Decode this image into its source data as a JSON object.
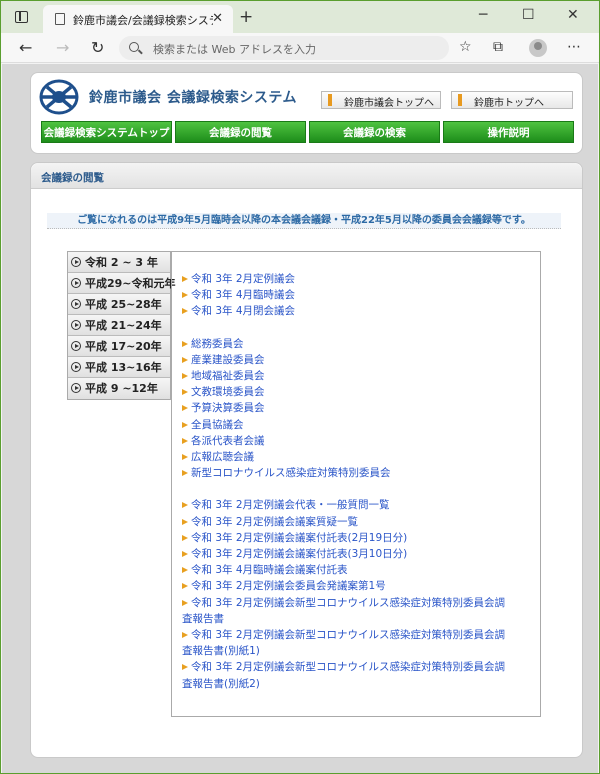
{
  "browser": {
    "tab_title": "鈴鹿市議会/会議録検索システム",
    "tab_close": "✕",
    "new_tab": "+",
    "address_placeholder": "検索または Web アドレスを入力",
    "back": "←",
    "forward": "→",
    "reload": "↻",
    "minimize": "─",
    "maximize": "☐",
    "close": "✕"
  },
  "header": {
    "site_title": "鈴鹿市議会 会議録検索システム",
    "links": [
      "鈴鹿市議会トップへ",
      "鈴鹿市トップへ"
    ],
    "menu": [
      "会議録検索システムトップ",
      "会議録の閲覧",
      "会議録の検索",
      "操作説明"
    ]
  },
  "section": {
    "title": "会議録の閲覧",
    "notice": "ご覧になれるのは平成9年5月臨時会以降の本会議会議録・平成22年5月以降の委員会会議録等です。"
  },
  "year_nav": [
    "令和 2 ~ 3 年",
    "平成29~令和元年",
    "平成 25~28年",
    "平成 21~24年",
    "平成 17~20年",
    "平成 13~16年",
    "平成 9 ~12年"
  ],
  "link_groups": [
    [
      "令和 3年 2月定例議会",
      "令和 3年 4月臨時議会",
      "令和 3年 4月閉会議会"
    ],
    [
      "総務委員会",
      "産業建設委員会",
      "地域福祉委員会",
      "文教環境委員会",
      "予算決算委員会",
      "全員協議会",
      "各派代表者会議",
      "広報広聴会議",
      "新型コロナウイルス感染症対策特別委員会"
    ],
    [
      "令和 3年 2月定例議会代表・一般質問一覧",
      "令和 3年 2月定例議会議案質疑一覧",
      "令和 3年 2月定例議会議案付託表(2月19日分)",
      "令和 3年 2月定例議会議案付託表(3月10日分)",
      "令和 3年 4月臨時議会議案付託表",
      "令和 3年 2月定例議会委員会発議案第1号"
    ]
  ],
  "wrapped_links": [
    {
      "line1": "令和 3年 2月定例議会新型コロナウイルス感染症対策特別委員会調",
      "line2": "査報告書"
    },
    {
      "line1": "令和 3年 2月定例議会新型コロナウイルス感染症対策特別委員会調",
      "line2": "査報告書(別紙1)"
    },
    {
      "line1": "令和 3年 2月定例議会新型コロナウイルス感染症対策特別委員会調",
      "line2": "査報告書(別紙2)"
    }
  ],
  "colors": {
    "accent_green": "#1d8d1a",
    "link_blue": "#2a55c8",
    "title_blue": "#2d5b8c",
    "arrow_orange": "#e8a020"
  }
}
